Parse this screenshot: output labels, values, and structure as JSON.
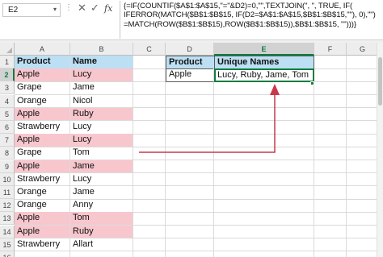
{
  "formula_bar": {
    "name_box": "E2",
    "fx": "fx",
    "formula_lines": [
      "{=IF(COUNTIF($A$1:$A$15,\"=\"&D2)=0,\"\",TEXTJOIN(\", \", TRUE, IF(",
      "IFERROR(MATCH($B$1:$B$15, IF(D2=$A$1:$A$15,$B$1:$B$15,\"\"), 0),\"\")",
      "=MATCH(ROW($B$1:$B$15),ROW($B$1:$B$15)),$B$1:$B$15, \"\")))}"
    ]
  },
  "columns": [
    "A",
    "B",
    "C",
    "D",
    "E",
    "F",
    "G"
  ],
  "selected_column": "E",
  "selected_row": "2",
  "rows": [
    "1",
    "2",
    "3",
    "4",
    "5",
    "6",
    "7",
    "8",
    "9",
    "10",
    "11",
    "12",
    "13",
    "14",
    "15",
    "16"
  ],
  "table": {
    "header": [
      "Product",
      "Name"
    ],
    "records": [
      {
        "product": "Apple",
        "name": "Lucy",
        "highlight": true
      },
      {
        "product": "Grape",
        "name": "Jame",
        "highlight": false
      },
      {
        "product": "Orange",
        "name": "Nicol",
        "highlight": false
      },
      {
        "product": "Apple",
        "name": "Ruby",
        "highlight": true
      },
      {
        "product": "Strawberry",
        "name": "Lucy",
        "highlight": false
      },
      {
        "product": "Apple",
        "name": "Lucy",
        "highlight": true
      },
      {
        "product": "Grape",
        "name": "Tom",
        "highlight": false
      },
      {
        "product": "Apple",
        "name": "Jame",
        "highlight": true
      },
      {
        "product": "Strawberry",
        "name": "Lucy",
        "highlight": false
      },
      {
        "product": "Orange",
        "name": "Jame",
        "highlight": false
      },
      {
        "product": "Orange",
        "name": "Anny",
        "highlight": false
      },
      {
        "product": "Apple",
        "name": "Tom",
        "highlight": true
      },
      {
        "product": "Apple",
        "name": "Ruby",
        "highlight": true
      },
      {
        "product": "Strawberry",
        "name": "Allart",
        "highlight": false
      }
    ]
  },
  "result_table": {
    "header_product": "Product",
    "header_names": "Unique Names",
    "product": "Apple",
    "unique_names": "Lucy, Ruby, Jame, Tom"
  },
  "colors": {
    "header_fill": "#bcdff3",
    "highlight_fill": "#f8c7ce",
    "selection_green": "#107c41",
    "arrow_red": "#c8384a"
  }
}
